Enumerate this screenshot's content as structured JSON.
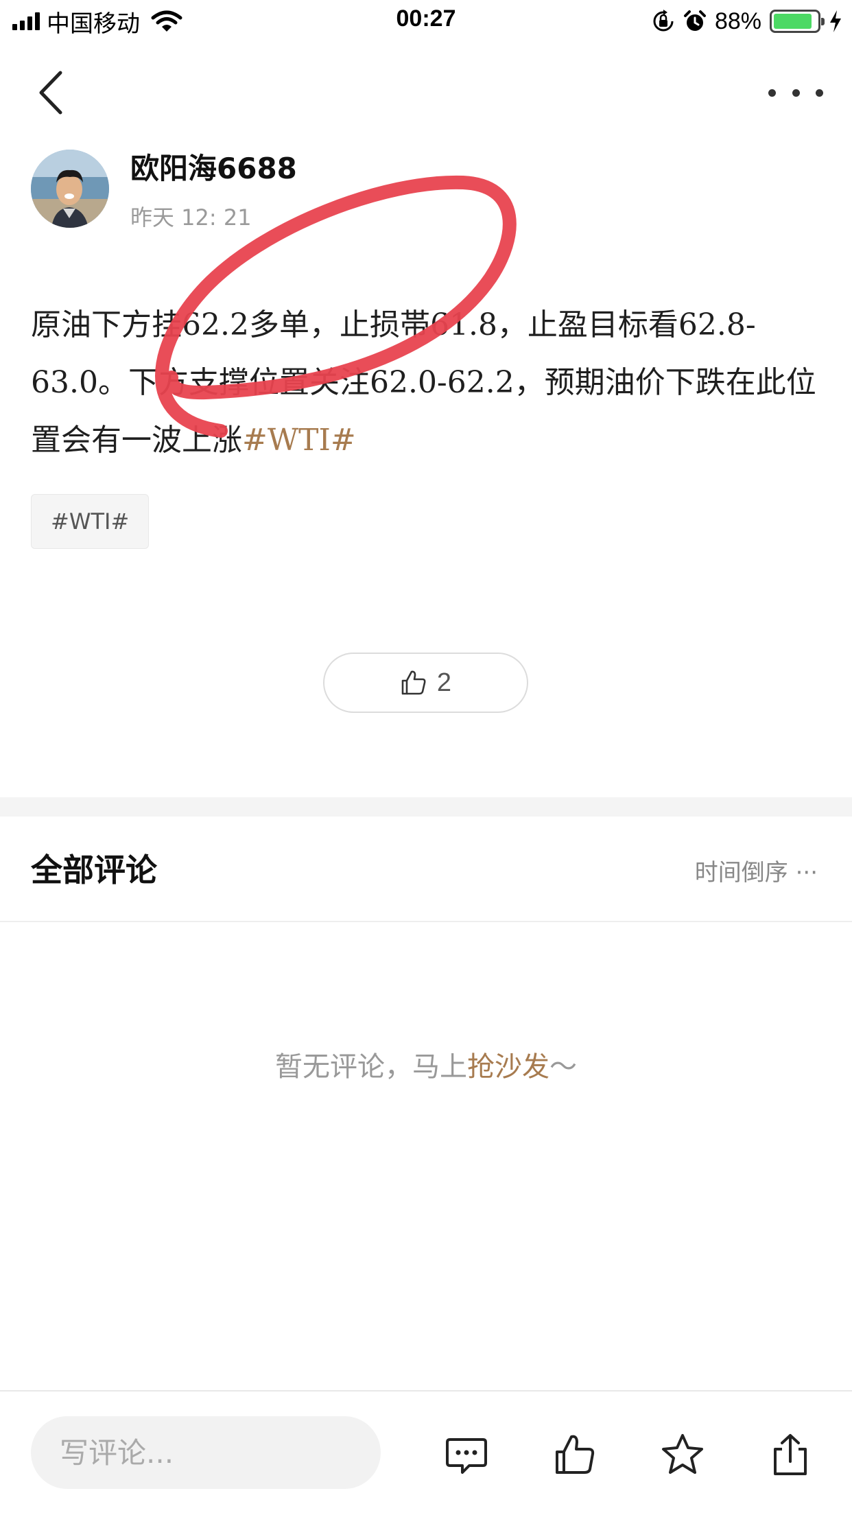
{
  "status_bar": {
    "carrier": "中国移动",
    "time": "00:27",
    "battery_pct": "88%",
    "battery_level": 0.88,
    "icons": [
      "signal-icon",
      "wifi-icon",
      "orientation-lock-icon",
      "alarm-icon",
      "battery-icon",
      "charging-icon"
    ]
  },
  "nav": {
    "back_icon": "chevron-left-icon",
    "more_icon": "more-dots-icon"
  },
  "author": {
    "name": "欧阳海6688",
    "time": "昨天 12: 21"
  },
  "post": {
    "text": "原油下方挂62.2多单，止损帯61.8，止盈目标看62.8-63.0。下方支撑位置关注62.0-62.2，预期油价下跌在此位置会有一波上涨",
    "inline_tag": "#WTI#",
    "tag_chip": "#WTI#"
  },
  "like": {
    "icon": "thumbs-up-icon",
    "count": "2"
  },
  "comments": {
    "title": "全部评论",
    "sort": "时间倒序",
    "empty_prefix": "暂无评论，马上",
    "empty_link": "抢沙发",
    "empty_suffix": "～"
  },
  "bottom_bar": {
    "input_placeholder": "写评论...",
    "icons": [
      "comment-icon",
      "like-icon",
      "star-icon",
      "share-icon"
    ]
  },
  "colors": {
    "accent": "#a77b4f",
    "annotation": "#e8434f",
    "battery": "#4cd964"
  }
}
